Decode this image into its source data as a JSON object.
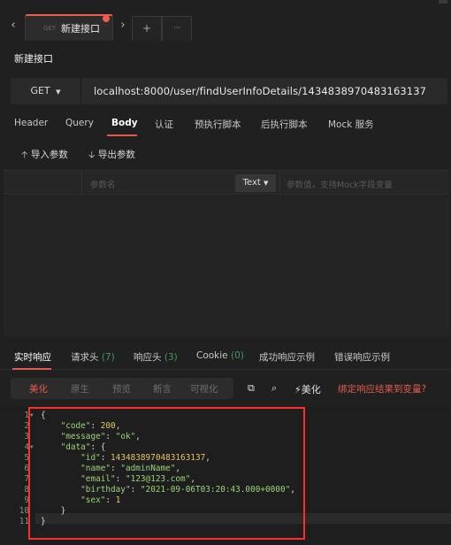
{
  "tab": {
    "method": "GET",
    "title": "新建接口"
  },
  "tabbar": {
    "prev": "‹",
    "next": "›",
    "add": "+",
    "more": "···"
  },
  "page_title": "新建接口",
  "request": {
    "method": "GET",
    "url": "localhost:8000/user/findUserInfoDetails/1434838970483163137"
  },
  "request_tabs": [
    "Header",
    "Query",
    "Body",
    "认证",
    "预执行脚本",
    "后执行脚本",
    "Mock 服务"
  ],
  "actions": {
    "import": "导入参数",
    "export": "导出参数"
  },
  "params": {
    "name_placeholder": "参数名",
    "type": "Text",
    "value_placeholder": "参数值，支持Mock字段变量"
  },
  "response_tabs": [
    {
      "label": "实时响应",
      "count": ""
    },
    {
      "label": "请求头",
      "count": "(7)"
    },
    {
      "label": "响应头",
      "count": "(3)"
    },
    {
      "label": "Cookie",
      "count": "(0)"
    },
    {
      "label": "成功响应示例",
      "count": ""
    },
    {
      "label": "错误响应示例",
      "count": ""
    }
  ],
  "view_modes": [
    "美化",
    "原生",
    "预览",
    "断言",
    "可视化"
  ],
  "tools": {
    "beautify": "美化",
    "bind_link": "绑定响应结果到变量?"
  },
  "response_json": {
    "code": "200",
    "message": "\"ok\"",
    "id": "1434838970483163137",
    "name": "\"adminName\"",
    "email": "\"123@123.com\"",
    "birthday": "\"2021-09-06T03:20:43.000+0000\"",
    "sex": "1"
  },
  "line_numbers": [
    "1",
    "2",
    "3",
    "4",
    "5",
    "6",
    "7",
    "8",
    "9",
    "10",
    "11"
  ],
  "colors": {
    "accent": "#e05b4e",
    "string": "#9ad27a",
    "number": "#e6c36a",
    "annotation_box": "#ff2d2d"
  }
}
